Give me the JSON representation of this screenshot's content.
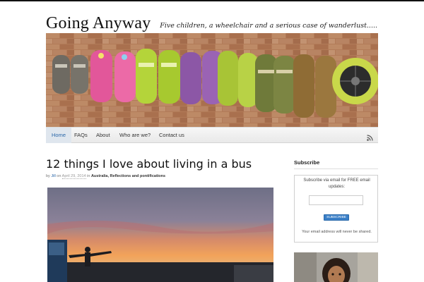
{
  "site": {
    "title": "Going Anyway",
    "tagline": "Five children, a wheelchair and a serious case of wanderlust....."
  },
  "banner": {
    "alt": "Row of children's sandals and a wheelchair wheel against a brick wall",
    "colors": {
      "brick": "#b07a57",
      "pink": "#e85a9b",
      "lime": "#b5d63a",
      "purple": "#8e5aa8",
      "olive": "#8a8a3a",
      "wheel": "#c8d84a"
    }
  },
  "nav": {
    "items": [
      {
        "label": "Home",
        "active": true
      },
      {
        "label": "FAQs",
        "active": false
      },
      {
        "label": "About",
        "active": false
      },
      {
        "label": "Who are we?",
        "active": false
      },
      {
        "label": "Contact us",
        "active": false
      }
    ],
    "rss_icon": "rss-icon",
    "active_color": "#2a67a8"
  },
  "post": {
    "title": "12 things I love about living in a bus",
    "meta": {
      "by": "by",
      "author": "Jill",
      "on": "on",
      "date": "April 29, 2014",
      "in": "in",
      "categories": "Australia, Reflections and pontifications"
    },
    "image_alt": "Silhouette of a person with arms outstretched at sunset beside a bus"
  },
  "sidebar": {
    "subscribe_title": "Subscribe",
    "subscribe_text": "Subscribe via email for FREE email updates:",
    "email_value": "",
    "email_placeholder": "",
    "button_label": "SUBSCRIBE",
    "privacy": "Your email address will never be shared."
  }
}
